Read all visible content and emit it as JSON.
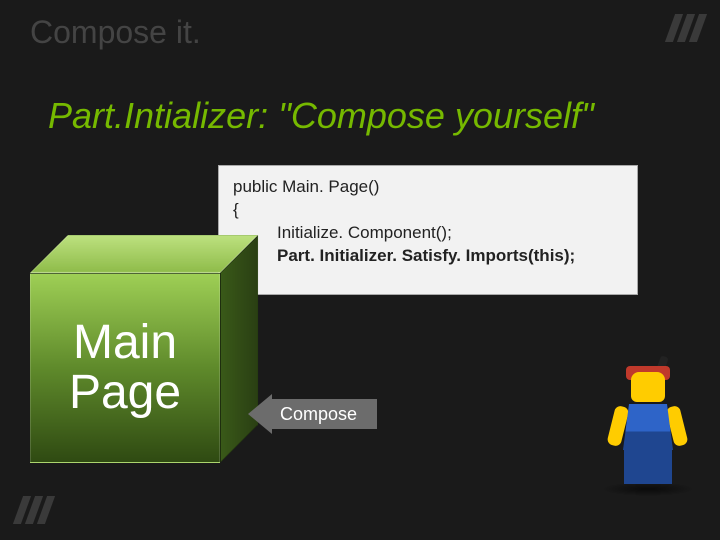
{
  "title": "Compose it.",
  "subheading": "Part.Intializer: \"Compose yourself\"",
  "code": {
    "line1": "public Main. Page()",
    "line2": "{",
    "line3": "Initialize. Component();",
    "line4": "Part. Initializer. Satisfy. Imports(this);",
    "line5": "}"
  },
  "cube_label_line1": "Main",
  "cube_label_line2": "Page",
  "arrow_label": "Compose"
}
